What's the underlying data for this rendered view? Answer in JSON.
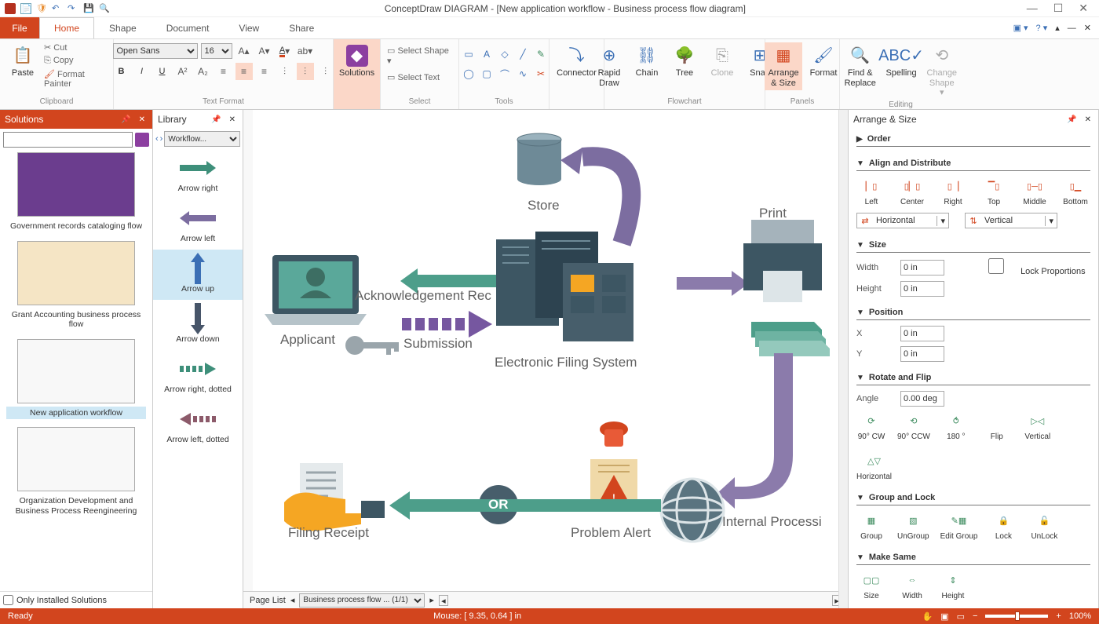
{
  "app": {
    "title": "ConceptDraw DIAGRAM - [New application workflow - Business process flow diagram]"
  },
  "window_buttons": {
    "min": "—",
    "max": "☐",
    "close": "✕"
  },
  "menu": {
    "file": "File",
    "home": "Home",
    "shape": "Shape",
    "document": "Document",
    "view": "View",
    "share": "Share"
  },
  "ribbon": {
    "clipboard": {
      "paste": "Paste",
      "cut": "Cut",
      "copy": "Copy",
      "format_painter": "Format Painter",
      "label": "Clipboard"
    },
    "text_format": {
      "font": "Open Sans",
      "size": "16",
      "label": "Text Format"
    },
    "solutions": {
      "label": "Solutions"
    },
    "select": {
      "select_shape": "Select Shape",
      "select_text": "Select Text",
      "label": "Select"
    },
    "tools": {
      "label": "Tools"
    },
    "connector": {
      "label": "Connector"
    },
    "flowchart": {
      "rapid": "Rapid Draw",
      "chain": "Chain",
      "tree": "Tree",
      "clone": "Clone",
      "snap": "Snap",
      "label": "Flowchart"
    },
    "panels": {
      "arrange": "Arrange & Size",
      "format": "Format",
      "label": "Panels"
    },
    "editing": {
      "find": "Find & Replace",
      "spelling": "Spelling",
      "change": "Change Shape",
      "label": "Editing"
    }
  },
  "solutions_panel": {
    "title": "Solutions",
    "footer_check": "Only Installed Solutions",
    "items": [
      {
        "name": "Government records cataloging flow"
      },
      {
        "name": "Grant Accounting business process flow"
      },
      {
        "name": "New application workflow"
      },
      {
        "name": "Organization Development and Business Process Reengineering"
      }
    ]
  },
  "library_panel": {
    "title": "Library",
    "dropdown": "Workflow...",
    "items": [
      {
        "name": "Arrow right"
      },
      {
        "name": "Arrow left"
      },
      {
        "name": "Arrow up"
      },
      {
        "name": "Arrow down"
      },
      {
        "name": "Arrow right, dotted"
      },
      {
        "name": "Arrow left, dotted"
      }
    ]
  },
  "canvas": {
    "labels": {
      "store": "Store",
      "print": "Print",
      "applicant": "Applicant",
      "ack": "Acknowledgement Rec",
      "submission": "Submission",
      "efs": "Electronic Filing System",
      "filing_receipt": "Filing Receipt",
      "or": "OR",
      "problem_alert": "Problem Alert",
      "internal": "Internal Processi"
    }
  },
  "arrange_panel": {
    "title": "Arrange & Size",
    "sections": {
      "order": "Order",
      "align": "Align and Distribute",
      "size": "Size",
      "position": "Position",
      "rotate": "Rotate and Flip",
      "group": "Group and Lock",
      "same": "Make Same"
    },
    "align": {
      "left": "Left",
      "center": "Center",
      "right": "Right",
      "top": "Top",
      "middle": "Middle",
      "bottom": "Bottom",
      "horizontal": "Horizontal",
      "vertical": "Vertical"
    },
    "size": {
      "width": "Width",
      "height": "Height",
      "w_val": "0 in",
      "h_val": "0 in",
      "lock": "Lock Proportions"
    },
    "position": {
      "x": "X",
      "y": "Y",
      "x_val": "0 in",
      "y_val": "0 in"
    },
    "rotate": {
      "angle": "Angle",
      "angle_val": "0.00 deg",
      "cw": "90° CW",
      "ccw": "90° CCW",
      "r180": "180 °",
      "flip": "Flip",
      "v": "Vertical",
      "h": "Horizontal"
    },
    "group": {
      "group": "Group",
      "ungroup": "UnGroup",
      "edit": "Edit Group",
      "lock": "Lock",
      "unlock": "UnLock"
    },
    "same": {
      "size": "Size",
      "width": "Width",
      "height": "Height"
    }
  },
  "page_bar": {
    "label": "Page List",
    "selected": "Business process flow ...  (1/1)"
  },
  "status": {
    "ready": "Ready",
    "mouse": "Mouse: [ 9.35, 0.64 ] in",
    "zoom": "100%"
  }
}
